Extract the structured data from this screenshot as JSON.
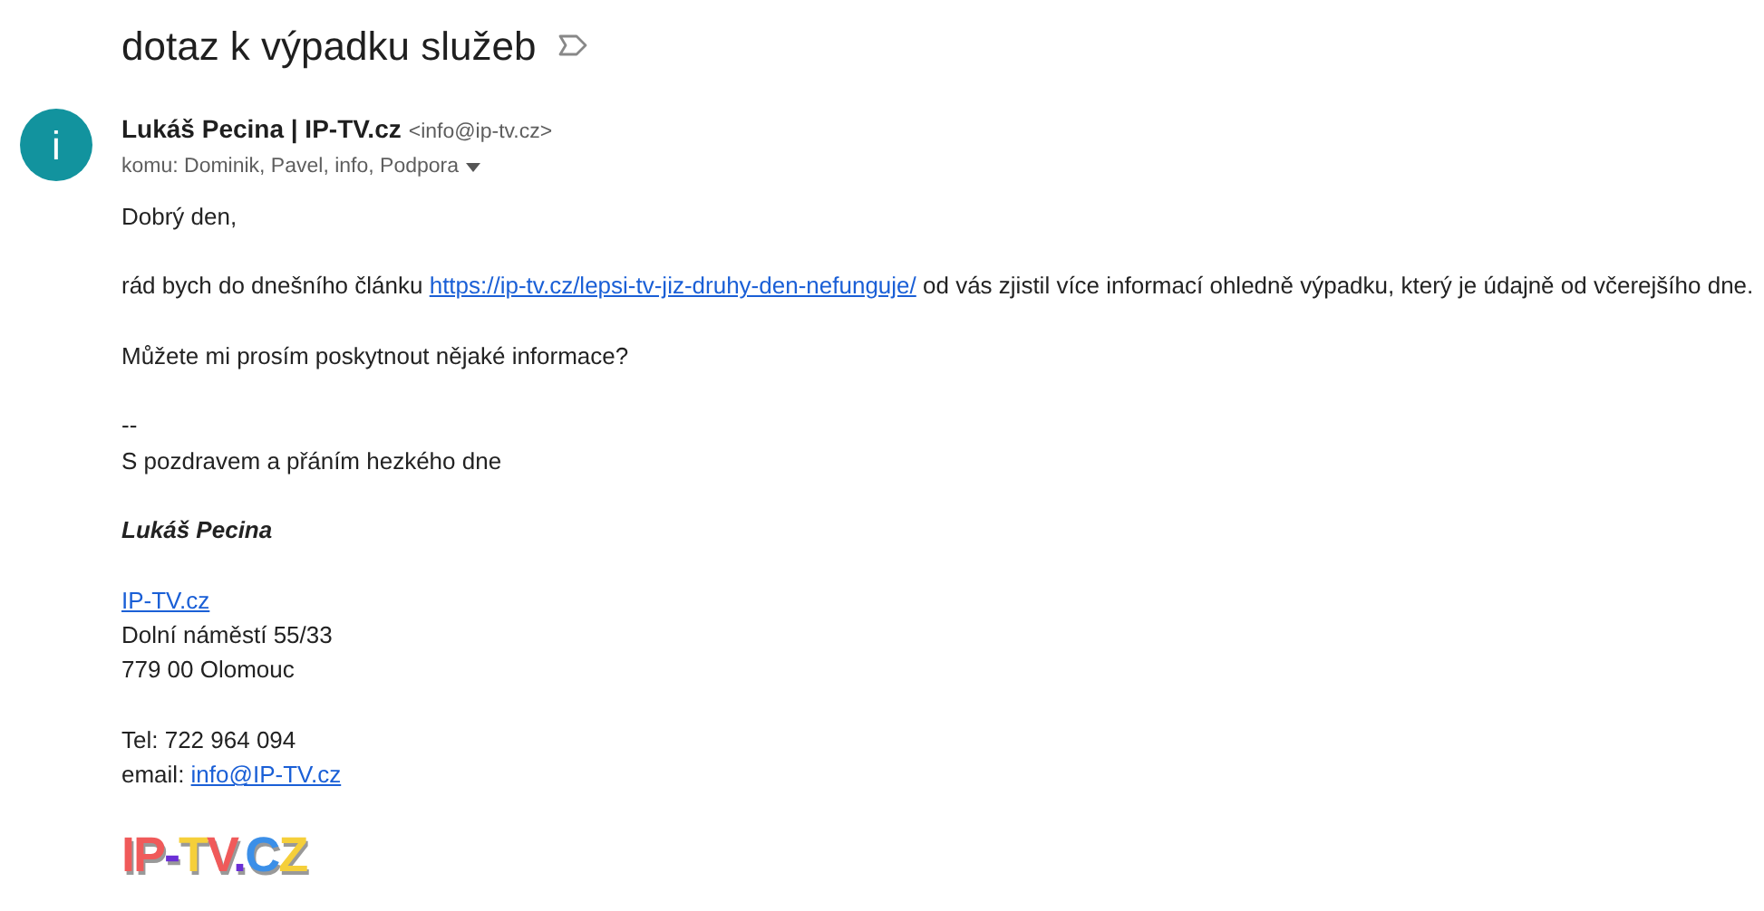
{
  "subject": "dotaz k výpadku služeb",
  "sender": {
    "avatar": "i",
    "name": "Lukáš Pecina | IP-TV.cz",
    "email": "<info@ip-tv.cz>",
    "recipients": "komu: Dominik, Pavel, info, Podpora"
  },
  "body": [
    [
      [
        {
          "text": "Dobrý den,",
          "link": false
        }
      ]
    ],
    [
      [
        {
          "text": "rád bych do dnešního článku ",
          "link": false
        },
        {
          "text": "https://ip-tv.cz/lepsi-tv-jiz-druhy-den-nefunguje/",
          "link": true
        },
        {
          "text": " od vás zjistil více informací ohledně výpadku, který je údajně od včerejšího dne.",
          "link": false
        }
      ]
    ],
    [
      [
        {
          "text": "Můžete mi prosím poskytnout nějaké informace?",
          "link": false
        }
      ]
    ],
    [
      [
        {
          "text": "--",
          "link": false
        }
      ],
      [
        {
          "text": "S pozdravem a přáním hezkého dne",
          "link": false
        }
      ]
    ],
    [
      [
        {
          "text": "Lukáš Pecina",
          "link": false,
          "bold_italic": true
        }
      ]
    ],
    [
      [
        {
          "text": "IP-TV.cz",
          "link": true
        }
      ],
      [
        {
          "text": "Dolní náměstí 55/33",
          "link": false
        }
      ],
      [
        {
          "text": "779 00 Olomouc",
          "link": false
        }
      ]
    ],
    [
      [
        {
          "text": "Tel: 722 964 094",
          "link": false
        }
      ],
      [
        {
          "text": "email: ",
          "link": false
        },
        {
          "text": "info@IP-TV.cz",
          "link": true
        }
      ]
    ]
  ],
  "logo": [
    {
      "text": "IP",
      "color": "#f05a5a"
    },
    {
      "text": "-",
      "color": "#6b2fd6"
    },
    {
      "text": "T",
      "color": "#f5cf3a"
    },
    {
      "text": "V",
      "color": "#f05a5a"
    },
    {
      "text": ".",
      "color": "#6b2fd6"
    },
    {
      "text": "C",
      "color": "#3b8fe8"
    },
    {
      "text": "Z",
      "color": "#f5cf3a"
    }
  ]
}
